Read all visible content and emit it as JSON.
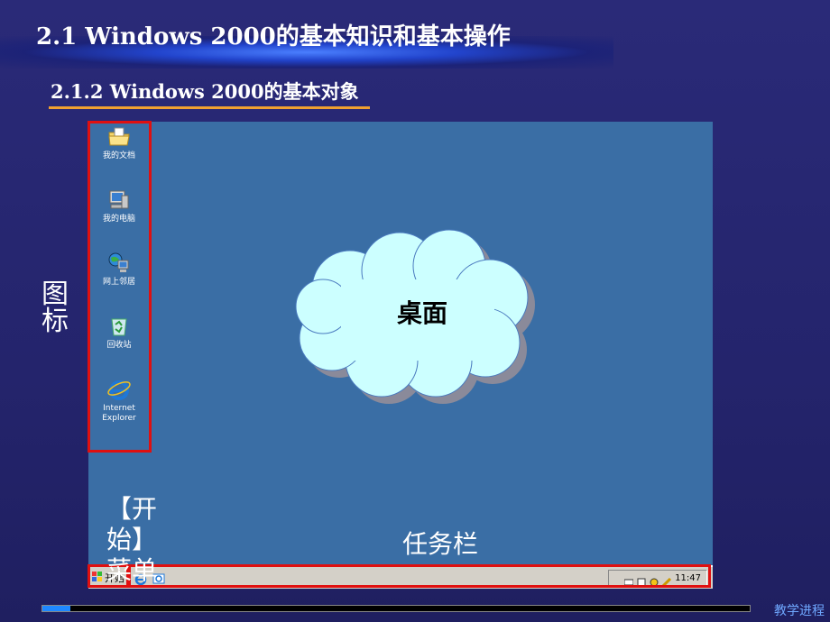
{
  "slide": {
    "title": "2.1  Windows 2000的基本知识和基本操作",
    "subtitle": "2.1.2 Windows 2000的基本对象"
  },
  "desktop": {
    "icons": [
      {
        "label": "我的文档",
        "icon": "my-documents-icon"
      },
      {
        "label": "我的电脑",
        "icon": "my-computer-icon"
      },
      {
        "label": "网上邻居",
        "icon": "network-places-icon"
      },
      {
        "label": "回收站",
        "icon": "recycle-bin-icon"
      },
      {
        "label": "Internet Explorer",
        "icon": "internet-explorer-icon"
      }
    ],
    "cloud_label": "桌面"
  },
  "taskbar": {
    "start_label": "开始",
    "clock": "11:47"
  },
  "annotations": {
    "icons_label": "图标",
    "start_menu_label": "【开始】\n菜单",
    "taskbar_label": "任务栏"
  },
  "footer": {
    "nav_label": "教学进程",
    "progress": 0.04
  },
  "colors": {
    "background": "#24246c",
    "desktop": "#3a6ea5",
    "highlight_frame": "#e01010",
    "underline": "#f0a030"
  }
}
